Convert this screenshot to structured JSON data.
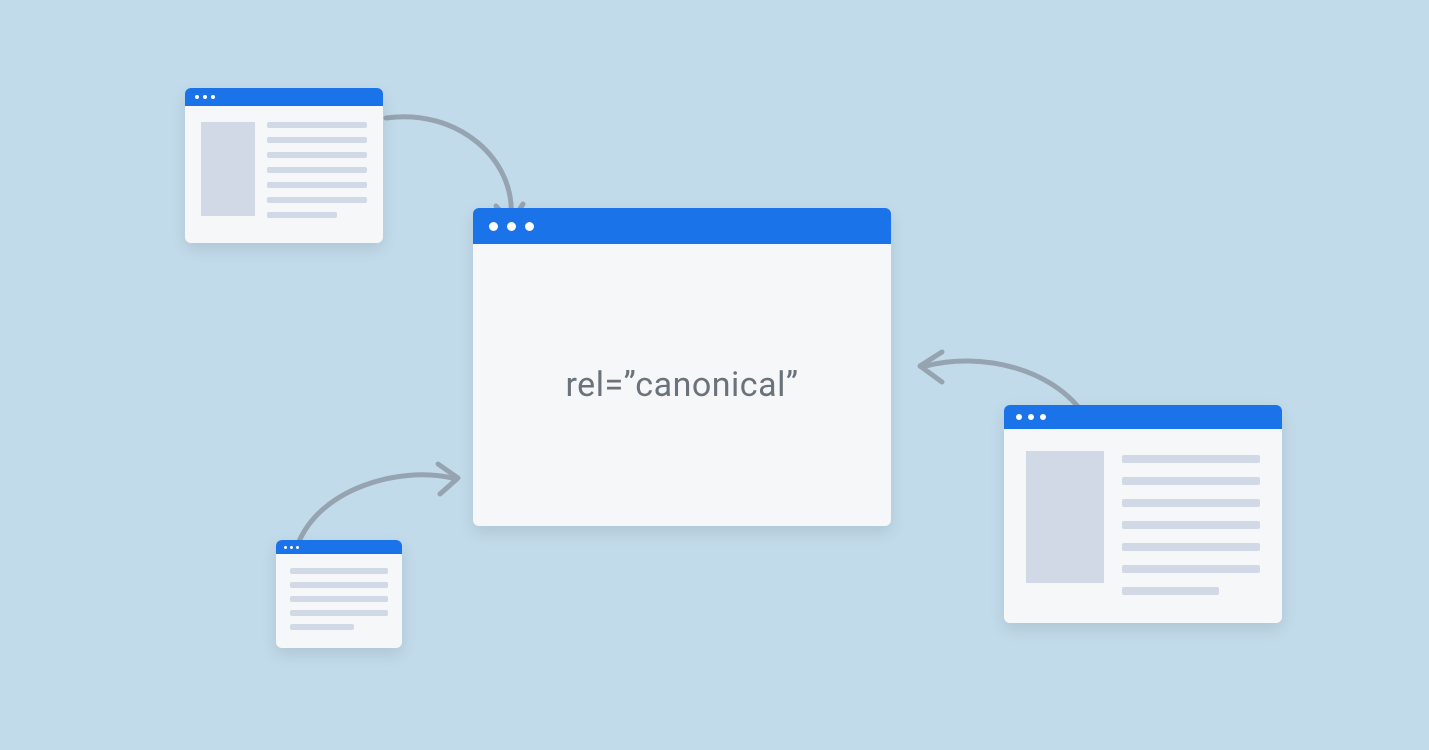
{
  "main_window": {
    "label": "rel=”canonical”"
  },
  "duplicate_windows": [
    {
      "position": "top-left",
      "has_thumbnail": true,
      "line_count": 7
    },
    {
      "position": "bottom-left",
      "has_thumbnail": false,
      "line_count": 5
    },
    {
      "position": "right",
      "has_thumbnail": true,
      "line_count": 7
    }
  ],
  "colors": {
    "background": "#c2dbea",
    "window_bg": "#f6f7f8",
    "titlebar": "#1a73e8",
    "placeholder": "#d1d9e6",
    "arrow": "#96a3b0",
    "text": "#6a727b"
  }
}
